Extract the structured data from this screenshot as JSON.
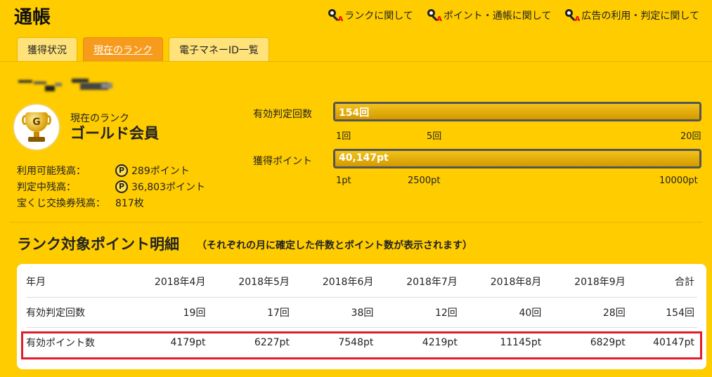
{
  "header": {
    "title": "通帳"
  },
  "help_links": [
    {
      "label": "ランクに関して"
    },
    {
      "label": "ポイント・通帳に関して"
    },
    {
      "label": "広告の利用・判定に関して"
    }
  ],
  "tabs": [
    {
      "label": "獲得状況"
    },
    {
      "label": "現在のランク"
    },
    {
      "label": "電子マネーID一覧"
    }
  ],
  "rank": {
    "label": "現在のランク",
    "name": "ゴールド会員",
    "badge_letter": "G"
  },
  "balances": [
    {
      "label": "利用可能残高：",
      "value": "289ポイント"
    },
    {
      "label": "判定中残高：",
      "value": "36,803ポイント"
    },
    {
      "label": "宝くじ交換券残高：",
      "value": "817枚"
    }
  ],
  "gauges": [
    {
      "label": "有効判定回数",
      "value_text": "154回",
      "fill_fraction": 1.0,
      "ticks": [
        "1回",
        "5回",
        "20回"
      ]
    },
    {
      "label": "獲得ポイント",
      "value_text": "40,147pt",
      "fill_fraction": 1.0,
      "ticks": [
        "1pt",
        "2500pt",
        "10000pt"
      ]
    }
  ],
  "section": {
    "title": "ランク対象ポイント明細",
    "subtitle": "（それぞれの月に確定した件数とポイント数が表示されます）"
  },
  "table": {
    "headers": [
      "年月",
      "2018年4月",
      "2018年5月",
      "2018年6月",
      "2018年7月",
      "2018年8月",
      "2018年9月",
      "合計"
    ],
    "rows": [
      [
        "有効判定回数",
        "19回",
        "17回",
        "38回",
        "12回",
        "40回",
        "28回",
        "154回"
      ],
      [
        "有効ポイント数",
        "4179pt",
        "6227pt",
        "7548pt",
        "4219pt",
        "11145pt",
        "6829pt",
        "40147pt"
      ]
    ]
  },
  "colors": {
    "background": "#ffcc00",
    "active_tab": "#f79b1d",
    "highlight": "#e01e2b"
  }
}
